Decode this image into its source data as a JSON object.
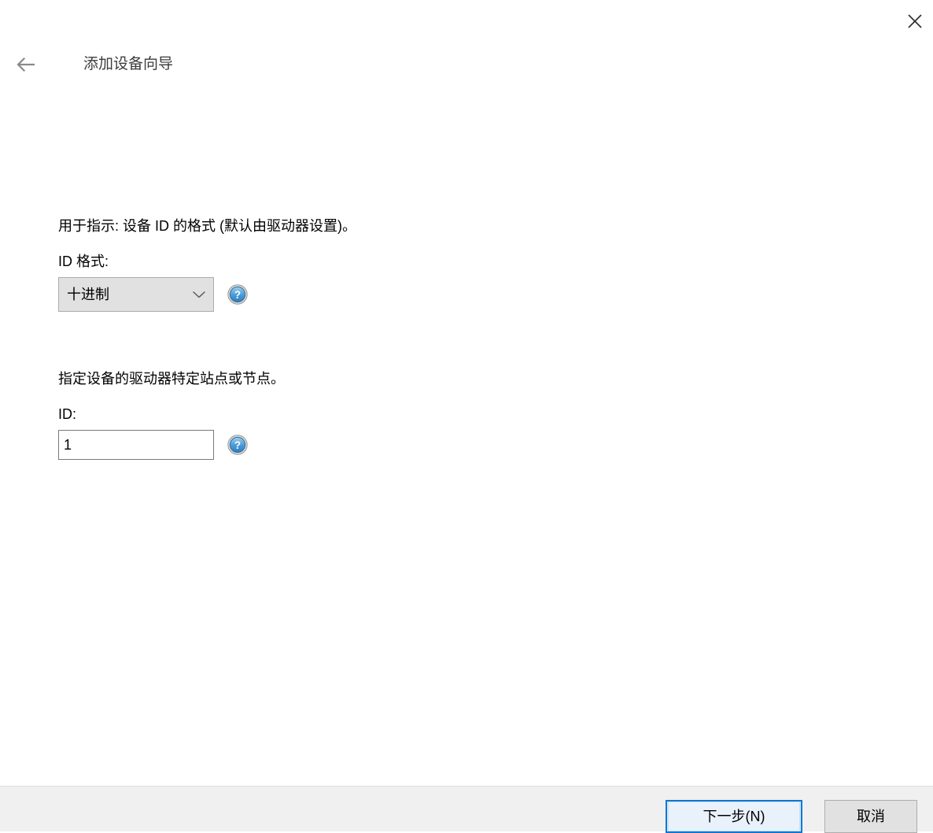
{
  "window": {
    "title": "添加设备向导",
    "close_label": "关闭",
    "back_label": "返回"
  },
  "content": {
    "sections": [
      {
        "description": "用于指示: 设备 ID 的格式 (默认由驱动器设置)。",
        "label": "ID 格式:",
        "control": "combobox",
        "value": "十进制",
        "options": [
          "十进制"
        ],
        "help_label": "?"
      },
      {
        "description": "指定设备的驱动器特定站点或节点。",
        "label": "ID:",
        "control": "textbox",
        "value": "1",
        "placeholder": "",
        "help_label": "?"
      }
    ]
  },
  "footer": {
    "next_label": "下一步(N)",
    "cancel_label": "取消"
  },
  "colors": {
    "accent": "#0078d7",
    "footer_bg": "#f0f0f0",
    "control_bg": "#e1e1e1",
    "title_text": "#3b3b3b"
  }
}
